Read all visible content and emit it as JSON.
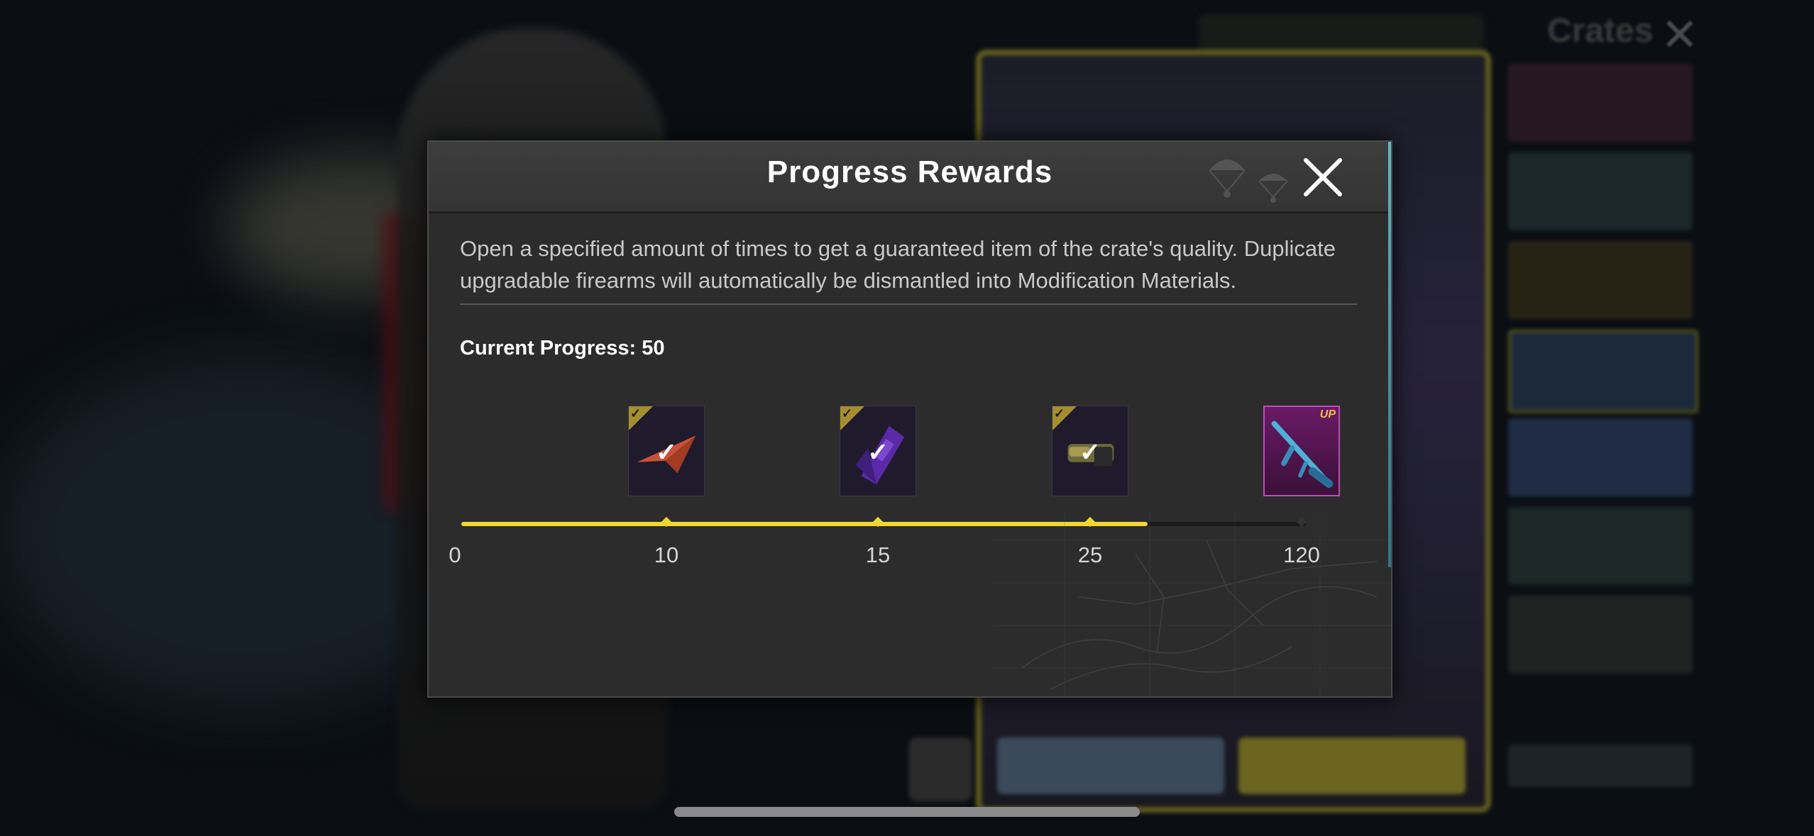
{
  "background": {
    "title": "Crates"
  },
  "modal": {
    "title": "Progress Rewards",
    "description": "Open a specified amount of times to get a guaranteed item of the crate's quality. Duplicate upgradable firearms will automatically be dismantled into Modification Materials.",
    "progress_label": "Current Progress: 50",
    "current_progress": 50,
    "rewards": [
      {
        "threshold": "10",
        "icon": "red-paper-plane-item-icon",
        "claimed": true
      },
      {
        "threshold": "15",
        "icon": "purple-backpack-item-icon",
        "claimed": true
      },
      {
        "threshold": "25",
        "icon": "gold-parachute-item-icon",
        "claimed": true
      },
      {
        "threshold": "120",
        "icon": "blue-rifle-skin-icon",
        "claimed": false,
        "badge": "UP"
      }
    ],
    "start_label": "0",
    "colors": {
      "progress": "#f3d631",
      "rare_border": "#c04cb8",
      "claimed_tag": "#a58e2e"
    }
  }
}
